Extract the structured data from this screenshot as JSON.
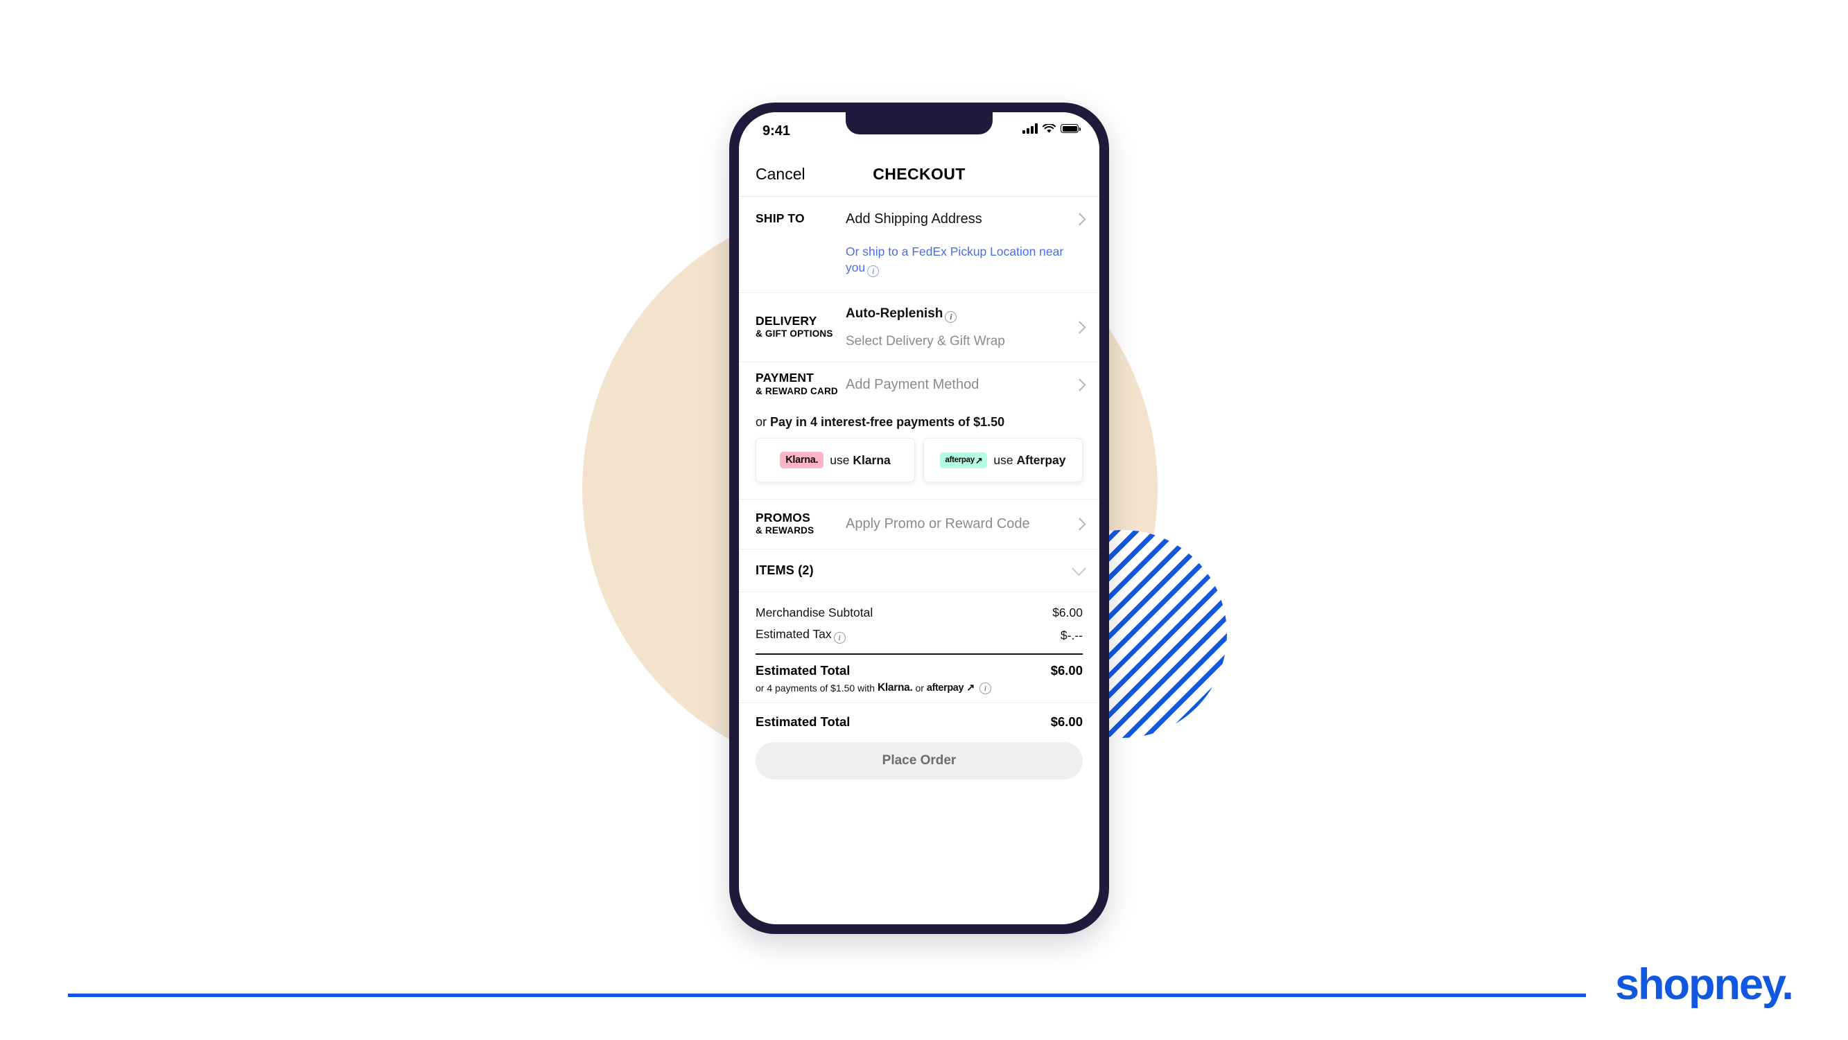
{
  "brand": {
    "logo_text": "shopney.",
    "accent_blue": "#1257e0",
    "frame_navy": "#1e1b3c",
    "beige": "#f3e3cd"
  },
  "phone": {
    "status_bar": {
      "time": "9:41",
      "signal_icon": "cellular-signal-icon",
      "wifi_icon": "wifi-icon",
      "battery_icon": "battery-icon"
    },
    "nav": {
      "cancel_label": "Cancel",
      "title": "CHECKOUT"
    },
    "ship_to": {
      "label": "SHIP TO",
      "value": "Add Shipping Address",
      "alt_link": "Or ship to a FedEx Pickup Location near you",
      "info_icon": "info-icon",
      "chevron_icon": "chevron-right-icon"
    },
    "delivery": {
      "label_main": "DELIVERY",
      "label_sub": "& GIFT OPTIONS",
      "top_value": "Auto-Replenish",
      "info_icon": "info-icon",
      "bottom_value": "Select Delivery & Gift Wrap",
      "chevron_icon": "chevron-right-icon"
    },
    "payment": {
      "label_main": "PAYMENT",
      "label_sub": "& REWARD CARD",
      "value": "Add Payment Method",
      "chevron_icon": "chevron-right-icon",
      "pay_in_4_prefix": "or ",
      "pay_in_4_bold": "Pay in 4 interest-free payments of $1.50",
      "options": [
        {
          "badge_text": "Klarna.",
          "badge_color": "#ffb3c7",
          "prefix": "use ",
          "name": "Klarna"
        },
        {
          "badge_text": "afterpay",
          "badge_glyph": "↗",
          "badge_color": "#b2fce4",
          "prefix": "use ",
          "name": "Afterpay"
        }
      ]
    },
    "promos": {
      "label_main": "PROMOS",
      "label_sub": "& REWARDS",
      "value": "Apply Promo or Reward Code",
      "chevron_icon": "chevron-right-icon"
    },
    "items": {
      "title": "ITEMS (2)",
      "chevron_icon": "chevron-down-icon"
    },
    "totals": {
      "lines": [
        {
          "key": "Merchandise Subtotal",
          "value": "$6.00",
          "has_info": false
        },
        {
          "key": "Estimated Tax",
          "value": "$-.--",
          "has_info": true
        }
      ],
      "grand_key": "Estimated Total",
      "grand_value": "$6.00",
      "note_prefix": "or 4 payments of $1.50 with ",
      "note_klarna": "Klarna.",
      "note_or": " or ",
      "note_afterpay": "afterpay",
      "note_afterpay_glyph": "↗",
      "note_info_icon": "info-icon",
      "grand2_key": "Estimated Total",
      "grand2_value": "$6.00"
    },
    "place_order_label": "Place Order"
  }
}
